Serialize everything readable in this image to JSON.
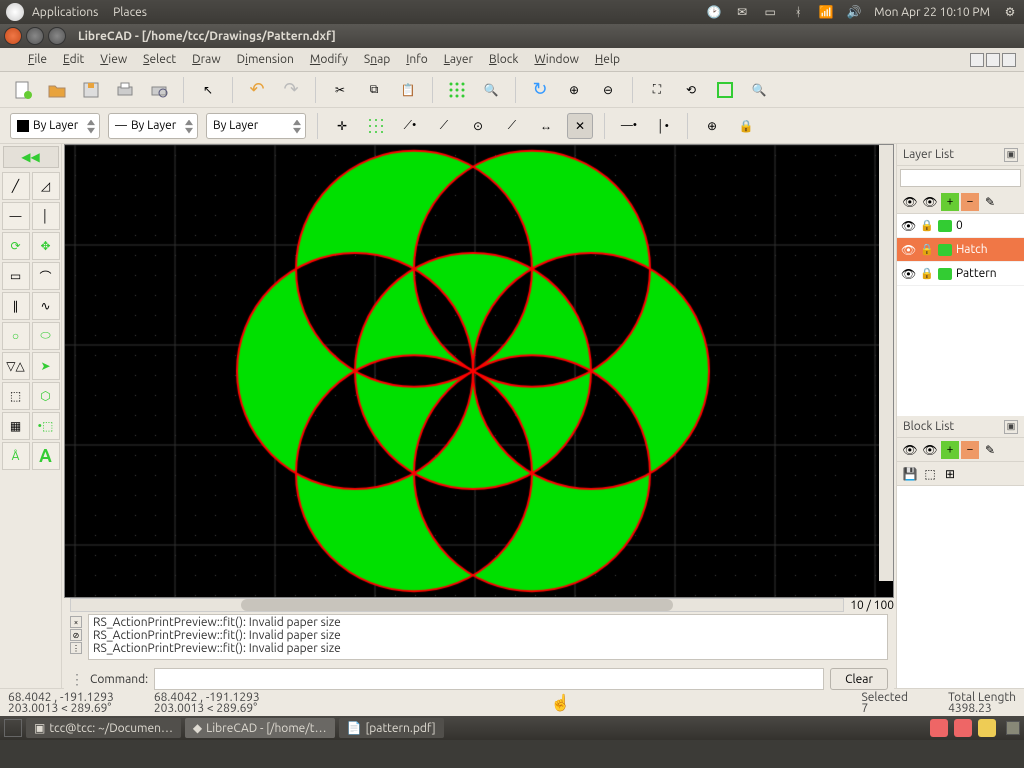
{
  "system": {
    "applications": "Applications",
    "places": "Places",
    "clock": "Mon Apr 22  10:10 PM"
  },
  "window": {
    "title": "LibreCAD - [/home/tcc/Drawings/Pattern.dxf]"
  },
  "menu": {
    "file": "File",
    "edit": "Edit",
    "view": "View",
    "select": "Select",
    "draw": "Draw",
    "dimension": "Dimension",
    "modify": "Modify",
    "snap": "Snap",
    "info": "Info",
    "layer": "Layer",
    "block": "Block",
    "window": "Window",
    "help": "Help"
  },
  "combos": {
    "color": "By Layer",
    "width": "By Layer",
    "ltype": "By Layer"
  },
  "layerPanel": {
    "title": "Layer List",
    "layers": [
      {
        "name": "0",
        "selected": false
      },
      {
        "name": "Hatch",
        "selected": true
      },
      {
        "name": "Pattern",
        "selected": false
      }
    ]
  },
  "blockPanel": {
    "title": "Block List"
  },
  "hscroll": {
    "label": "10 / 100"
  },
  "log": {
    "l1": "RS_ActionPrintPreview::fit(): Invalid paper size",
    "l2": "RS_ActionPrintPreview::fit(): Invalid paper size",
    "l3": "RS_ActionPrintPreview::fit(): Invalid paper size"
  },
  "command": {
    "label": "Command:",
    "clear": "Clear"
  },
  "status": {
    "c1a": "68.4042 , -191.1293",
    "c1b": "203.0013 < 289.69°",
    "c2a": "68.4042 , -191.1293",
    "c2b": "203.0013 < 289.69°",
    "selLabel": "Selected",
    "selVal": "7",
    "lenLabel": "Total Length",
    "lenVal": "4398.23"
  },
  "taskbar": {
    "t1": "tcc@tcc: ~/Documen…",
    "t2": "LibreCAD - [/home/t…",
    "t3": "[pattern.pdf]"
  }
}
